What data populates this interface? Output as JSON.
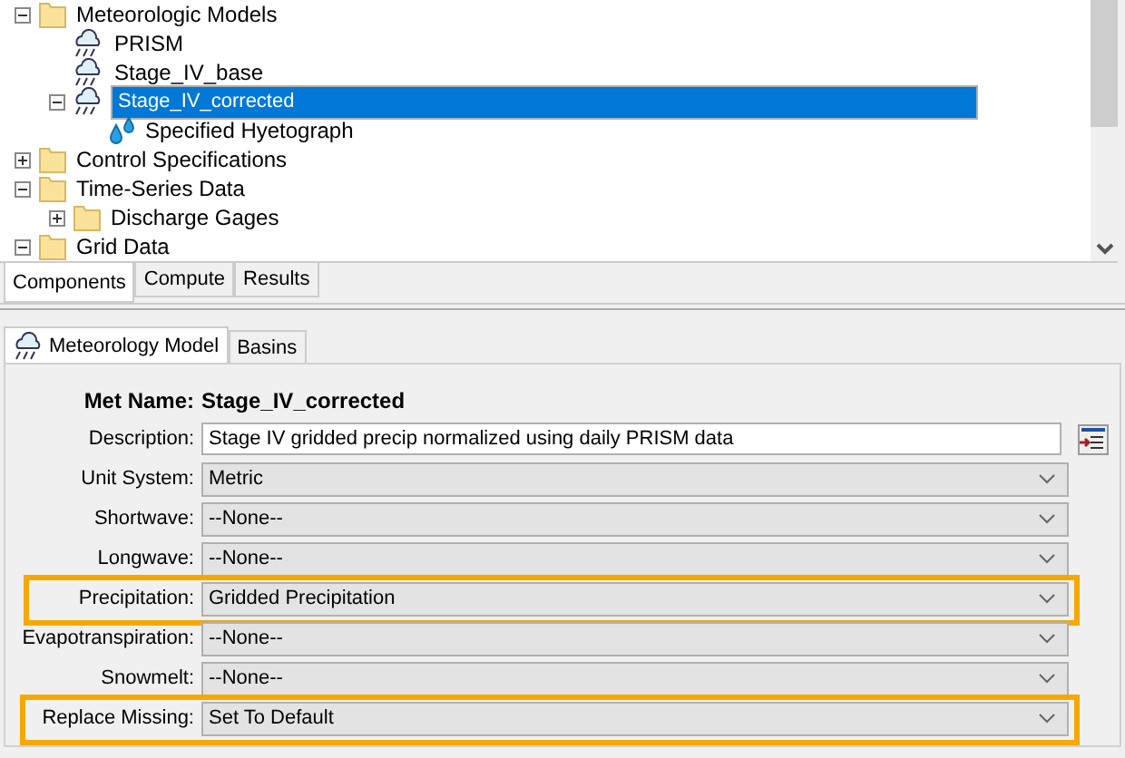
{
  "tree": [
    {
      "label": "Meteorologic Models",
      "kind": "folder",
      "expanded": true,
      "selected": false,
      "children": [
        {
          "label": "PRISM",
          "kind": "model",
          "selected": false
        },
        {
          "label": "Stage_IV_base",
          "kind": "model",
          "selected": false
        },
        {
          "label": "Stage_IV_corrected",
          "kind": "model",
          "selected": true,
          "expanded": true,
          "children": [
            {
              "label": "Specified Hyetograph",
              "kind": "hyetograph",
              "selected": false
            }
          ]
        }
      ]
    },
    {
      "label": "Control Specifications",
      "kind": "folder",
      "expanded": false,
      "selected": false
    },
    {
      "label": "Time-Series Data",
      "kind": "folder",
      "expanded": true,
      "selected": false,
      "children": [
        {
          "label": "Discharge Gages",
          "kind": "folder",
          "expanded": false,
          "selected": false
        }
      ]
    },
    {
      "label": "Grid Data",
      "kind": "folder",
      "expanded": true,
      "selected": false
    }
  ],
  "view_tabs": [
    {
      "label": "Components",
      "selected": true
    },
    {
      "label": "Compute",
      "selected": false
    },
    {
      "label": "Results",
      "selected": false
    }
  ],
  "editor_tabs": [
    {
      "label": "Meteorology Model",
      "selected": true
    },
    {
      "label": "Basins",
      "selected": false
    }
  ],
  "met_name": {
    "label": "Met Name:",
    "value": "Stage_IV_corrected"
  },
  "fields": [
    {
      "kind": "text",
      "label": "Description:",
      "value": "Stage IV gridded precip normalized using daily PRISM data",
      "highlighted": false
    },
    {
      "kind": "select",
      "label": "Unit System:",
      "value": "Metric",
      "highlighted": false
    },
    {
      "kind": "select",
      "label": "Shortwave:",
      "value": "--None--",
      "highlighted": false
    },
    {
      "kind": "select",
      "label": "Longwave:",
      "value": "--None--",
      "highlighted": false
    },
    {
      "kind": "select",
      "label": "Precipitation:",
      "value": "Gridded Precipitation",
      "highlighted": true
    },
    {
      "kind": "select",
      "label": "Evapotranspiration:",
      "value": "--None--",
      "highlighted": false
    },
    {
      "kind": "select",
      "label": "Snowmelt:",
      "value": "--None--",
      "highlighted": false
    },
    {
      "kind": "select",
      "label": "Replace Missing:",
      "value": "Set To Default",
      "highlighted": true
    }
  ]
}
